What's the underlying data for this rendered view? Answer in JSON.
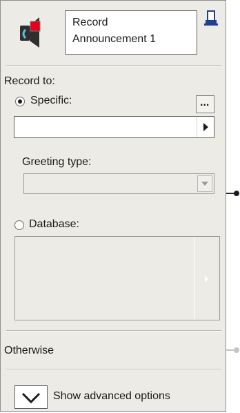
{
  "node": {
    "title_line1": "Record",
    "title_line2": "Announcement 1",
    "icon": "speaker-record-icon",
    "pin_icon": "pin-icon"
  },
  "record_to": {
    "label": "Record to:",
    "specific_label": "Specific:",
    "specific_selected": true,
    "browse_label": "...",
    "specific_value": "",
    "greeting_type_label": "Greeting type:",
    "greeting_type_value": "",
    "database_label": "Database:",
    "database_selected": false
  },
  "otherwise_label": "Otherwise",
  "advanced": {
    "label": "Show advanced options",
    "icon": "chevron-down-icon"
  },
  "colors": {
    "panel_bg": "#ecebe6",
    "record_red": "#e3001b",
    "pin_blue": "#1f3f8f"
  }
}
